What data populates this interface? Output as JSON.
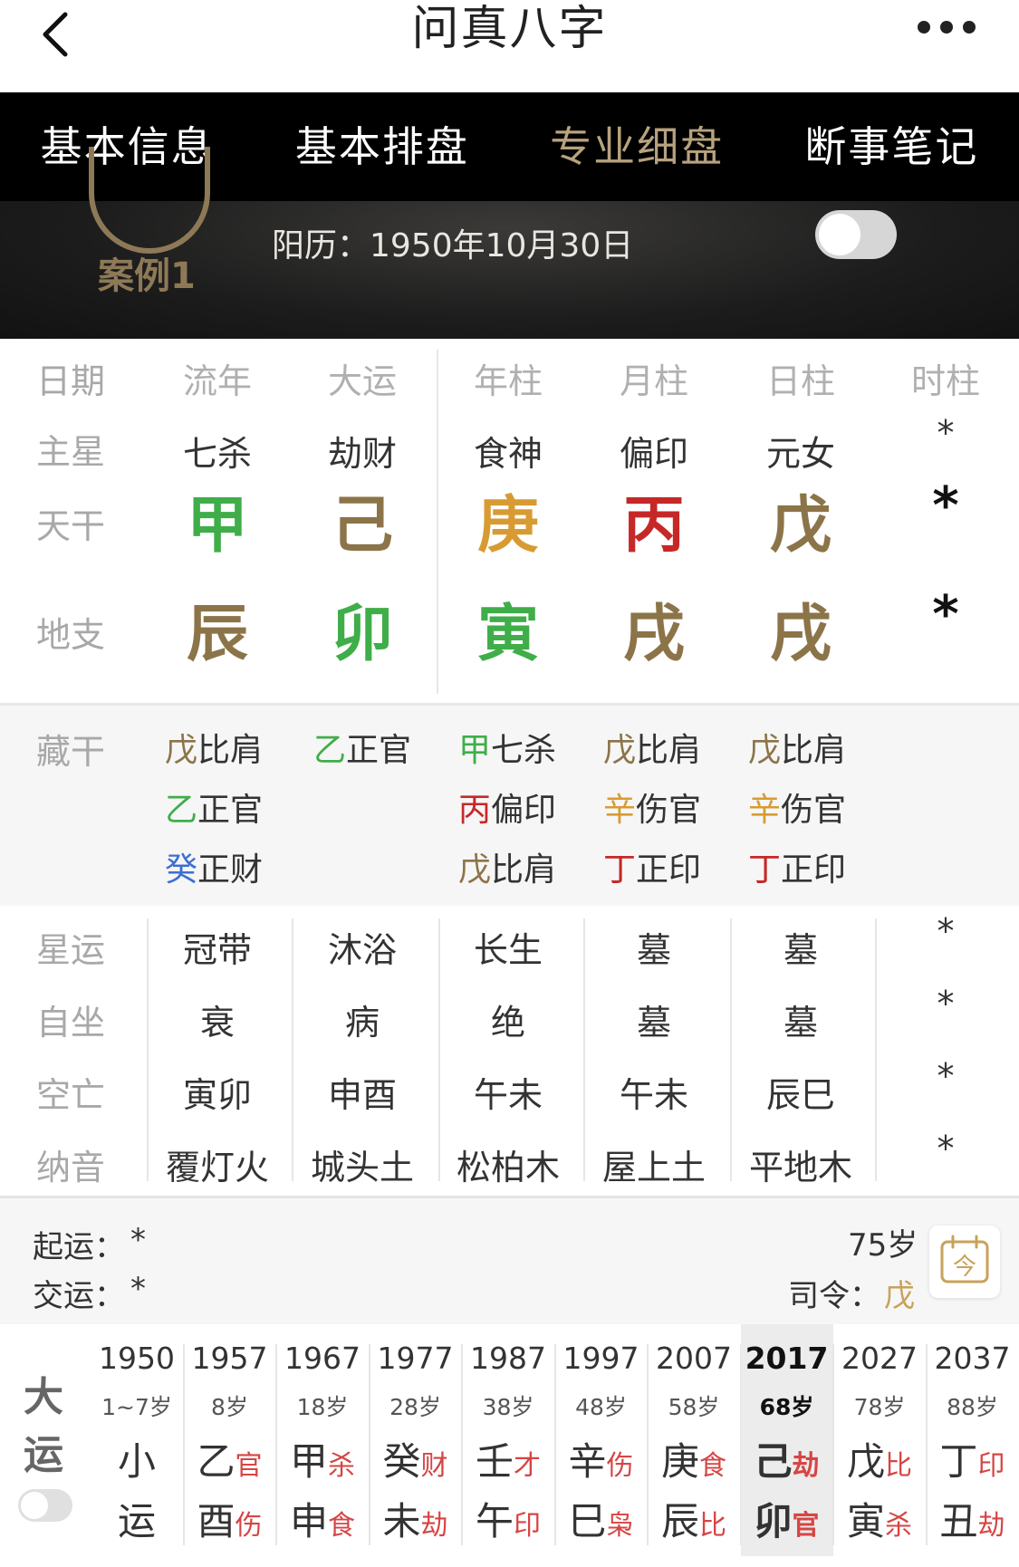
{
  "header": {
    "title": "问真八字"
  },
  "tabs": [
    {
      "label": "基本信息"
    },
    {
      "label": "基本排盘"
    },
    {
      "label": "专业细盘",
      "active": true
    },
    {
      "label": "断事笔记"
    }
  ],
  "banner": {
    "case_label": "案例1",
    "solar_date": "阳历：1950年10月30日"
  },
  "table": {
    "col_labels": [
      "流年",
      "大运",
      "年柱",
      "月柱",
      "日柱",
      "时柱"
    ],
    "row_labels": {
      "date": "日期",
      "main_star": "主星",
      "tiangan": "天干",
      "dizhi": "地支",
      "canggan": "藏干",
      "xingyun": "星运",
      "zizuo": "自坐",
      "kongwang": "空亡",
      "nayin": "纳音"
    },
    "main_star": [
      "七杀",
      "劫财",
      "食神",
      "偏印",
      "元女",
      "*"
    ],
    "tiangan": [
      {
        "char": "甲",
        "color": "#3fae49"
      },
      {
        "char": "己",
        "color": "#8c7449"
      },
      {
        "char": "庚",
        "color": "#d89b33"
      },
      {
        "char": "丙",
        "color": "#c62828"
      },
      {
        "char": "戊",
        "color": "#8c7449"
      },
      {
        "char": "*",
        "color": "#111111"
      }
    ],
    "dizhi": [
      {
        "char": "辰",
        "color": "#8c7449"
      },
      {
        "char": "卯",
        "color": "#3fae49"
      },
      {
        "char": "寅",
        "color": "#3fae49"
      },
      {
        "char": "戌",
        "color": "#8c7449"
      },
      {
        "char": "戌",
        "color": "#8c7449"
      },
      {
        "char": "*",
        "color": "#111111"
      }
    ],
    "canggan": [
      [
        {
          "g": "戊",
          "c": "#8c7449",
          "n": "比肩"
        },
        {
          "g": "乙",
          "c": "#3fae49",
          "n": "正官"
        },
        {
          "g": "癸",
          "c": "#3d6fd1",
          "n": "正财"
        }
      ],
      [
        {
          "g": "乙",
          "c": "#3fae49",
          "n": "正官"
        }
      ],
      [
        {
          "g": "甲",
          "c": "#3fae49",
          "n": "七杀"
        },
        {
          "g": "丙",
          "c": "#c62828",
          "n": "偏印"
        },
        {
          "g": "戊",
          "c": "#8c7449",
          "n": "比肩"
        }
      ],
      [
        {
          "g": "戊",
          "c": "#8c7449",
          "n": "比肩"
        },
        {
          "g": "辛",
          "c": "#d89b33",
          "n": "伤官"
        },
        {
          "g": "丁",
          "c": "#c62828",
          "n": "正印"
        }
      ],
      [
        {
          "g": "戊",
          "c": "#8c7449",
          "n": "比肩"
        },
        {
          "g": "辛",
          "c": "#d89b33",
          "n": "伤官"
        },
        {
          "g": "丁",
          "c": "#c62828",
          "n": "正印"
        }
      ]
    ],
    "xingyun": [
      "冠带",
      "沐浴",
      "长生",
      "墓",
      "墓",
      "*"
    ],
    "zizuo": [
      "衰",
      "病",
      "绝",
      "墓",
      "墓",
      "*"
    ],
    "kongwang": [
      "寅卯",
      "申酉",
      "午未",
      "午未",
      "辰巳",
      "*"
    ],
    "nayin": [
      "覆灯火",
      "城头土",
      "松柏木",
      "屋上土",
      "平地木",
      "*"
    ]
  },
  "yun_info": {
    "qiyun_label": "起运：",
    "qiyun_value": "*",
    "jiaoyun_label": "交运：",
    "jiaoyun_value": "*",
    "age": "75岁",
    "siling_label": "司令：",
    "siling_value": "戊",
    "calendar_icon_text": "今"
  },
  "dayun": {
    "label_1": "大",
    "label_2": "运",
    "columns": [
      {
        "year": "1950",
        "age": "1~7岁",
        "g1": "小",
        "s1": "",
        "g2": "运",
        "s2": ""
      },
      {
        "year": "1957",
        "age": "8岁",
        "g1": "乙",
        "s1": "官",
        "g2": "酉",
        "s2": "伤"
      },
      {
        "year": "1967",
        "age": "18岁",
        "g1": "甲",
        "s1": "杀",
        "g2": "申",
        "s2": "食"
      },
      {
        "year": "1977",
        "age": "28岁",
        "g1": "癸",
        "s1": "财",
        "g2": "未",
        "s2": "劫"
      },
      {
        "year": "1987",
        "age": "38岁",
        "g1": "壬",
        "s1": "才",
        "g2": "午",
        "s2": "印"
      },
      {
        "year": "1997",
        "age": "48岁",
        "g1": "辛",
        "s1": "伤",
        "g2": "巳",
        "s2": "枭"
      },
      {
        "year": "2007",
        "age": "58岁",
        "g1": "庚",
        "s1": "食",
        "g2": "辰",
        "s2": "比"
      },
      {
        "year": "2017",
        "age": "68岁",
        "g1": "己",
        "s1": "劫",
        "g2": "卯",
        "s2": "官",
        "selected": true
      },
      {
        "year": "2027",
        "age": "78岁",
        "g1": "戊",
        "s1": "比",
        "g2": "寅",
        "s2": "杀"
      },
      {
        "year": "2037",
        "age": "88岁",
        "g1": "丁",
        "s1": "印",
        "g2": "丑",
        "s2": "劫"
      }
    ]
  }
}
